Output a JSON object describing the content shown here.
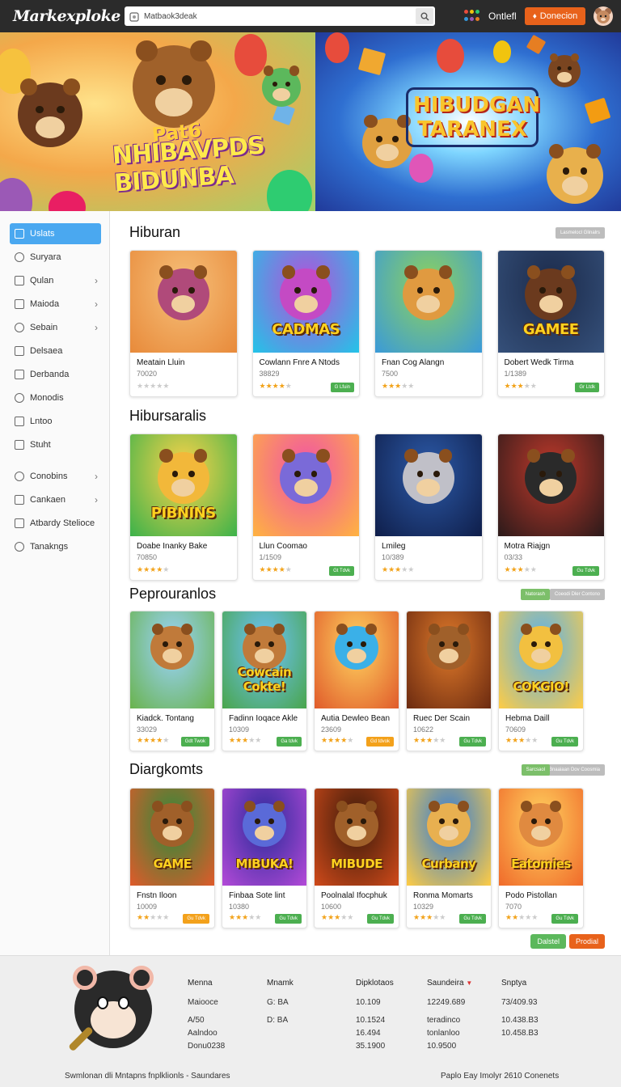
{
  "header": {
    "logo": "Markexploke",
    "search_value": "Matbaok3deak",
    "official": "Ontlefl",
    "donate": "Donecion"
  },
  "banner": {
    "left_pre": "Pat6",
    "left_title": "NHIBAVPDS BIDUNBA",
    "right_title": "HIBUDGAN TARANEX"
  },
  "sidebar": {
    "items": [
      {
        "label": "Uslats",
        "active": true,
        "chevron": false
      },
      {
        "label": "Suryara",
        "chevron": false
      },
      {
        "label": "Qulan",
        "chevron": true
      },
      {
        "label": "Maioda",
        "chevron": true
      },
      {
        "label": "Sebain",
        "chevron": true
      },
      {
        "label": "Delsaea",
        "chevron": false
      },
      {
        "label": "Derbanda",
        "chevron": false
      },
      {
        "label": "Monodis",
        "chevron": false
      },
      {
        "label": "Lntoo",
        "chevron": false
      },
      {
        "label": "Stuht",
        "chevron": false
      }
    ],
    "items2": [
      {
        "label": "Conobins",
        "chevron": true
      },
      {
        "label": "Cankaen",
        "chevron": true
      },
      {
        "label": "Atbardy Stelioce",
        "chevron": false
      },
      {
        "label": "Tanakngs",
        "chevron": false
      }
    ]
  },
  "sections": [
    {
      "title": "Hiburan",
      "buttons": [
        "Lasmelocl Glinalrs"
      ],
      "cards": [
        {
          "name": "Meatain Lluin",
          "num": "70020",
          "stars": 0,
          "badge": "",
          "thumb_title": ""
        },
        {
          "name": "Cowlann Fnre A Ntods",
          "num": "38829",
          "stars": 4,
          "badge": "G Lfuin",
          "thumb_title": "CADMAS"
        },
        {
          "name": "Fnan Cog Alangn",
          "num": "7500",
          "stars": 3,
          "badge": "",
          "thumb_title": ""
        },
        {
          "name": "Dobert Wedk Tirma",
          "num": "1/1389",
          "stars": 3,
          "badge": "Gr Ltdk",
          "thumb_title": "GAMEE"
        }
      ]
    },
    {
      "title": "Hibursaralis",
      "buttons": [],
      "cards": [
        {
          "name": "Doabe Inanky Bake",
          "num": "70850",
          "stars": 4,
          "badge": "",
          "thumb_title": "PIBNINS"
        },
        {
          "name": "Llun Coomao",
          "num": "1/1509",
          "stars": 4,
          "badge": "Gt Tdvk",
          "thumb_title": ""
        },
        {
          "name": "Lmileg",
          "num": "10/389",
          "stars": 3,
          "badge": "",
          "thumb_title": ""
        },
        {
          "name": "Motra Riajgn",
          "num": "03/33",
          "stars": 3,
          "badge": "Gu Tdvk",
          "thumb_title": ""
        }
      ]
    },
    {
      "title": "Peprouranlos",
      "buttons": [
        "Natorash",
        "Coeodi Dler Contono"
      ],
      "cards": [
        {
          "name": "Kiadck. Tontang",
          "num": "33029",
          "stars": 4,
          "badge": "Gdt Twok",
          "thumb_title": ""
        },
        {
          "name": "Fadinn Ioqace Akle",
          "num": "10309",
          "stars": 3,
          "badge": "Ga tdvk",
          "thumb_title": "Cowcain Cokte!"
        },
        {
          "name": "Autia Dewleo Bean",
          "num": "23609",
          "stars": 4,
          "badge": "Gd tdvok",
          "badge_orange": true,
          "thumb_title": ""
        },
        {
          "name": "Ruec Der Scain",
          "num": "10622",
          "stars": 3,
          "badge": "Gu Tdvk",
          "thumb_title": ""
        },
        {
          "name": "Hebma Daill",
          "num": "70609",
          "stars": 3,
          "badge": "Gu Tdvk",
          "thumb_title": "COKGIO!"
        }
      ]
    },
    {
      "title": "Diargkomts",
      "buttons": [
        "Sarcsaol",
        "Bnaaiaan Dov Coosmia"
      ],
      "cards": [
        {
          "name": "Fnstn Iloon",
          "num": "10009",
          "stars": 2,
          "badge": "Gu Tdvk",
          "badge_orange": true,
          "thumb_title": "GAME"
        },
        {
          "name": "Finbaa Sote lint",
          "num": "10380",
          "stars": 3,
          "badge": "Gu Tdvk",
          "thumb_title": "MIBUKA!"
        },
        {
          "name": "Poolnalal Ifocphuk",
          "num": "10600",
          "stars": 3,
          "badge": "Gu Tdvk",
          "thumb_title": "MIBUDE"
        },
        {
          "name": "Ronma Momarts",
          "num": "10329",
          "stars": 3,
          "badge": "Gu Tdvk",
          "thumb_title": "Curbany"
        },
        {
          "name": "Podo Pistollan",
          "num": "7070",
          "stars": 2,
          "badge": "Gu Tdvk",
          "thumb_title": "Eatomies"
        }
      ]
    }
  ],
  "bottom_buttons": [
    "Dalstel",
    "Prodial"
  ],
  "footer": {
    "col1": {
      "head": "Menna",
      "lines": [
        "Maiooce",
        "A/50",
        "Aalndoo",
        "Donu0238"
      ]
    },
    "col2": {
      "head": "Mnamk",
      "lines": [
        "G: BA",
        "D: BA"
      ]
    },
    "col3": {
      "head": "Dipklotaos",
      "lines": [
        "10.109",
        "10.1524",
        "16.494",
        "35.1900"
      ]
    },
    "col4": {
      "head": "Saundeira",
      "lines": [
        "12249.689",
        "teradinco",
        "tonlanloo",
        "10.9500"
      ]
    },
    "col5": {
      "head": "Snptya",
      "lines": [
        "73/409.93",
        "10.438.B3",
        "10.458.B3"
      ]
    },
    "left_text": "Swmlonan dli Mntapns fnplklionls -  Saundares",
    "right_text": "Paplo Eay Imolyr 2610 Conenets"
  },
  "colors": {
    "accent": "#4aa8f0",
    "donate": "#e8621b",
    "badge_green": "#4caf50",
    "badge_orange": "#f3a11b",
    "star": "#f2a31b"
  }
}
